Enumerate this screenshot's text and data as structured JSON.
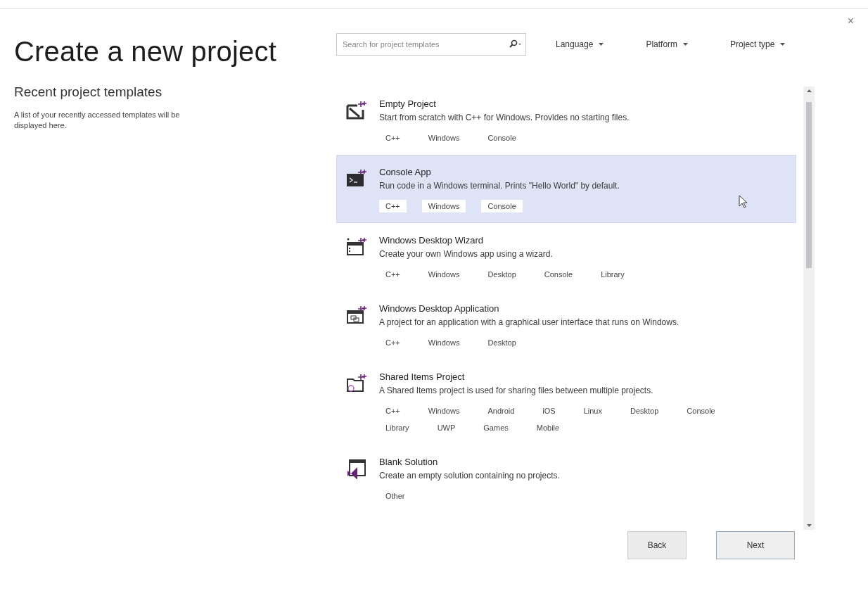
{
  "window": {
    "close": "×"
  },
  "title": "Create a new project",
  "recent": {
    "heading": "Recent project templates",
    "text": "A list of your recently accessed templates will be displayed here."
  },
  "search": {
    "placeholder": "Search for project templates"
  },
  "filters": [
    "Language",
    "Platform",
    "Project type"
  ],
  "templates": [
    {
      "name": "Empty Project",
      "description": "Start from scratch with C++ for Windows. Provides no starting files.",
      "tags": [
        "C++",
        "Windows",
        "Console"
      ],
      "selected": false
    },
    {
      "name": "Console App",
      "description": "Run code in a Windows terminal. Prints \"Hello World\" by default.",
      "tags": [
        "C++",
        "Windows",
        "Console"
      ],
      "selected": true
    },
    {
      "name": "Windows Desktop Wizard",
      "description": "Create your own Windows app using a wizard.",
      "tags": [
        "C++",
        "Windows",
        "Desktop",
        "Console",
        "Library"
      ],
      "selected": false
    },
    {
      "name": "Windows Desktop Application",
      "description": "A project for an application with a graphical user interface that runs on Windows.",
      "tags": [
        "C++",
        "Windows",
        "Desktop"
      ],
      "selected": false
    },
    {
      "name": "Shared Items Project",
      "description": "A Shared Items project is used for sharing files between multiple projects.",
      "tags": [
        "C++",
        "Windows",
        "Android",
        "iOS",
        "Linux",
        "Desktop",
        "Console",
        "Library",
        "UWP",
        "Games",
        "Mobile"
      ],
      "selected": false
    },
    {
      "name": "Blank Solution",
      "description": "Create an empty solution containing no projects.",
      "tags": [
        "Other"
      ],
      "selected": false
    }
  ],
  "buttons": [
    "Back",
    "Next"
  ]
}
